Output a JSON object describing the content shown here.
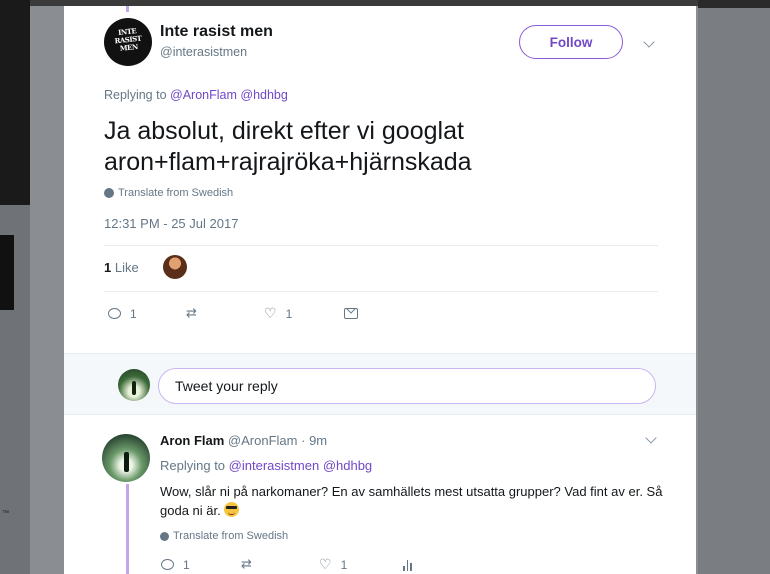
{
  "background": {
    "trademark_text": "™"
  },
  "colors": {
    "accent": "#7148c8",
    "thread_line": "#c4a6ea",
    "muted": "#657786"
  },
  "main_tweet": {
    "display_name": "Inte rasist men",
    "handle": "@interasistmen",
    "avatar_logo_text": "INTE RASIST MEN",
    "follow_label": "Follow",
    "replying_prefix": "Replying to",
    "replying_mentions": [
      "@AronFlam",
      "@hdhbg"
    ],
    "text_line1": "Ja absolut, direkt efter vi googlat",
    "text_line2": "aron+flam+rajrajröka+hjärnskada",
    "translate_label": "Translate from Swedish",
    "timestamp": "12:31 PM - 25 Jul 2017",
    "like_count": "1",
    "like_label": "Like",
    "actions": {
      "reply_count": "1",
      "retweet_count": "",
      "like_count": "1"
    }
  },
  "reply_box": {
    "placeholder": "Tweet your reply"
  },
  "reply_tweet": {
    "display_name": "Aron Flam",
    "handle": "@AronFlam",
    "separator": "·",
    "time": "9m",
    "replying_prefix": "Replying to",
    "replying_mentions": [
      "@interasistmen",
      "@hdhbg"
    ],
    "text": "Wow, slår ni på narkomaner? En av samhällets mest utsatta grupper? Vad fint av er. Så goda ni är.",
    "emoji_icon": "sunglasses-emoji-icon",
    "translate_label": "Translate from Swedish",
    "actions": {
      "reply_count": "1",
      "retweet_count": "",
      "like_count": "1"
    }
  }
}
